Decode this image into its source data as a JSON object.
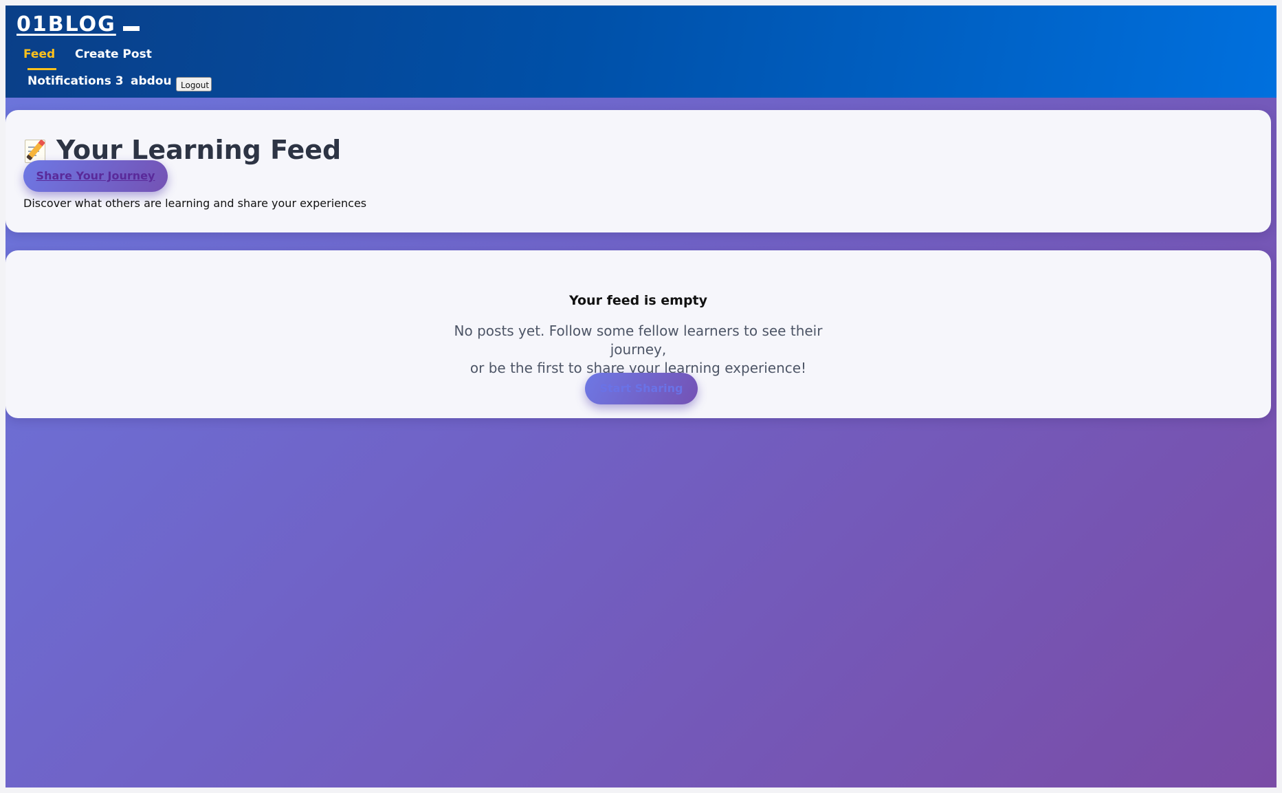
{
  "header": {
    "brand": "01BLOG",
    "nav": {
      "feed": "Feed",
      "create_post": "Create Post",
      "notifications": "Notifications 3",
      "username": "abdou",
      "logout": "Logout"
    }
  },
  "intro": {
    "title_icon": "memo-icon",
    "title": "Your Learning Feed",
    "share_button": "Share Your Journey",
    "subtitle": "Discover what others are learning and share your experiences"
  },
  "empty_state": {
    "title": "Your feed is empty",
    "line1": "No posts yet. Follow some fellow learners to see their journey,",
    "line2": "or be the first to share your learning experience!",
    "button": "Start Sharing"
  },
  "colors": {
    "header_dark": "#0a3f88",
    "header_light": "#0070de",
    "active_nav": "#ffc21c",
    "background_start": "#6b77dd",
    "background_end": "#7a4ca6",
    "card": "#f6f6fb"
  }
}
